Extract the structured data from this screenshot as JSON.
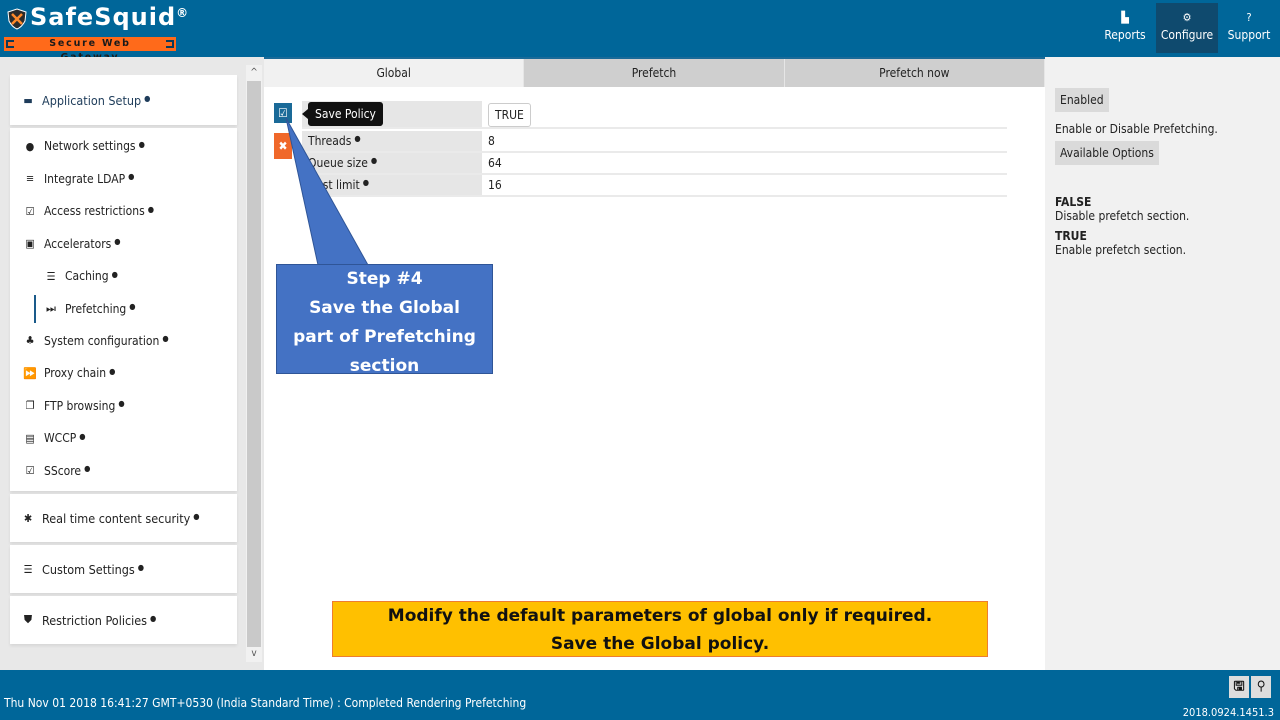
{
  "brand": {
    "name": "SafeSquid",
    "registered": "®",
    "tagline": "Secure Web Gateway",
    "colors": {
      "header": "#006699",
      "accent_orange": "#ff6a1a",
      "callout": "#4472c4",
      "note": "#ffc000"
    }
  },
  "nav": [
    {
      "label": "Reports",
      "icon": "chart-icon",
      "glyph": "▙",
      "active": false
    },
    {
      "label": "Configure",
      "icon": "gears-icon",
      "glyph": "⚙",
      "active": true
    },
    {
      "label": "Support",
      "icon": "question-icon",
      "glyph": "?",
      "active": false
    }
  ],
  "sidebar": {
    "info_glyph": "●",
    "groups": [
      {
        "label": "Application Setup",
        "icon": "briefcase-icon",
        "glyph": "▬"
      },
      {
        "label": "Real time content security",
        "icon": "bug-icon",
        "glyph": "✱"
      },
      {
        "label": "Custom Settings",
        "icon": "sliders-icon",
        "glyph": "☰"
      },
      {
        "label": "Restriction Policies",
        "icon": "shield-icon",
        "glyph": "⛊"
      }
    ],
    "items": [
      {
        "label": "Network settings",
        "icon": "globe-icon",
        "glyph": "●"
      },
      {
        "label": "Integrate LDAP",
        "icon": "list-icon",
        "glyph": "≡"
      },
      {
        "label": "Access restrictions",
        "icon": "check-square-icon",
        "glyph": "☑"
      },
      {
        "label": "Accelerators",
        "icon": "accelerator-icon",
        "glyph": "▣"
      },
      {
        "label": "Caching",
        "icon": "server-icon",
        "glyph": "☰"
      },
      {
        "label": "Prefetching",
        "icon": "step-forward-icon",
        "glyph": "⏭"
      },
      {
        "label": "System configuration",
        "icon": "sitemap-icon",
        "glyph": "♣"
      },
      {
        "label": "Proxy chain",
        "icon": "fast-forward-icon",
        "glyph": "⏩"
      },
      {
        "label": "FTP browsing",
        "icon": "copy-icon",
        "glyph": "❐"
      },
      {
        "label": "WCCP",
        "icon": "hdd-icon",
        "glyph": "▤"
      },
      {
        "label": "SScore",
        "icon": "check-square-icon",
        "glyph": "☑"
      }
    ]
  },
  "tabs": [
    {
      "label": "Global",
      "active": true
    },
    {
      "label": "Prefetch",
      "active": false
    },
    {
      "label": "Prefetch now",
      "active": false
    }
  ],
  "form": {
    "save_tooltip": "Save Policy",
    "rows": [
      {
        "label": "Enabled",
        "value": "TRUE"
      },
      {
        "label": "Threads",
        "value": "8"
      },
      {
        "label": "Queue size",
        "value": "64"
      },
      {
        "label": "Host limit",
        "value": "16"
      }
    ]
  },
  "callout": {
    "lines": [
      "Step #4",
      "Save the Global",
      "part of Prefetching",
      "section"
    ]
  },
  "note": {
    "lines": [
      "Modify the default parameters of global only if required.",
      "Save the Global policy."
    ]
  },
  "help": {
    "field": "Enabled",
    "description": "Enable or Disable Prefetching.",
    "options_label": "Available Options",
    "options": [
      {
        "name": "FALSE",
        "desc": "Disable prefetch section."
      },
      {
        "name": "TRUE",
        "desc": "Enable prefetch section."
      }
    ]
  },
  "footer": {
    "status": "Thu Nov 01 2018 16:41:27 GMT+0530 (India Standard Time) : Completed Rendering Prefetching",
    "version": "2018.0924.1451.3"
  }
}
